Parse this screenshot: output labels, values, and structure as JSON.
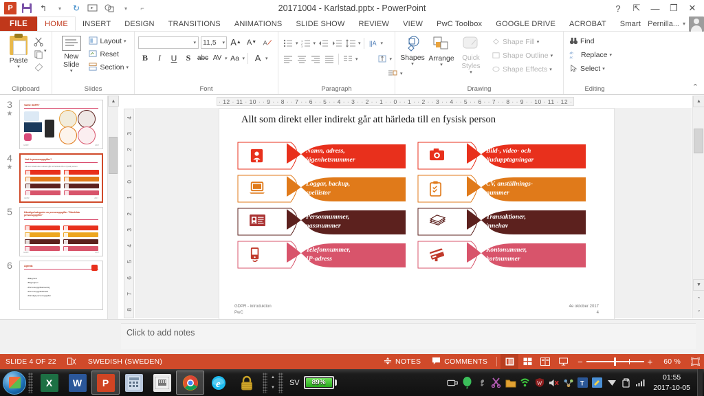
{
  "window": {
    "title": "20171004 - Karlstad.pptx - PowerPoint",
    "app_logo": "P",
    "quick_access": [
      {
        "name": "save",
        "glyph": "save-icon"
      },
      {
        "name": "undo",
        "glyph": "↰"
      },
      {
        "name": "redo",
        "glyph": "↻"
      },
      {
        "name": "start-slideshow",
        "glyph": "▭"
      },
      {
        "name": "shapes-qat",
        "glyph": "◇"
      },
      {
        "name": "customize-qat",
        "glyph": "▾"
      }
    ],
    "controls": {
      "help": "?",
      "ribbon_display": "⇱",
      "minimize": "—",
      "restore": "❐",
      "close": "✕"
    }
  },
  "tabs": {
    "file": "FILE",
    "items": [
      {
        "label": "HOME",
        "active": true
      },
      {
        "label": "INSERT",
        "active": false
      },
      {
        "label": "DESIGN",
        "active": false
      },
      {
        "label": "TRANSITIONS",
        "active": false
      },
      {
        "label": "ANIMATIONS",
        "active": false
      },
      {
        "label": "SLIDE SHOW",
        "active": false
      },
      {
        "label": "REVIEW",
        "active": false
      },
      {
        "label": "VIEW",
        "active": false
      },
      {
        "label": "PwC Toolbox",
        "active": false
      },
      {
        "label": "GOOGLE DRIVE",
        "active": false
      },
      {
        "label": "ACROBAT",
        "active": false
      },
      {
        "label": "Smart",
        "active": false
      }
    ],
    "account_name": "Pernilla...",
    "account_caret": "▾"
  },
  "ribbon": {
    "groups": [
      {
        "name": "clipboard",
        "label": "Clipboard",
        "paste_label": "Paste",
        "paste_caret": "▾",
        "items": [
          {
            "label": "Cut",
            "icon": "scissors-icon"
          },
          {
            "label": "Copy",
            "icon": "copy-icon"
          },
          {
            "label": "Format Painter",
            "icon": "format-painter-icon"
          }
        ]
      },
      {
        "name": "slides",
        "label": "Slides",
        "new_slide_label": "New Slide",
        "new_slide_caret": "▾",
        "items": [
          {
            "label": "Layout",
            "caret": "▾"
          },
          {
            "label": "Reset",
            "caret": ""
          },
          {
            "label": "Section",
            "caret": "▾"
          }
        ]
      },
      {
        "name": "font",
        "label": "Font",
        "font_name": "",
        "font_size": "11,5",
        "grow_font": "A",
        "shrink_font": "A",
        "clear_formatting": "Aᵈ",
        "buttons": [
          {
            "label": "B",
            "name": "bold"
          },
          {
            "label": "I",
            "name": "italic"
          },
          {
            "label": "U",
            "name": "underline"
          },
          {
            "label": "S",
            "name": "shadow"
          },
          {
            "label": "abc",
            "name": "strikethrough"
          },
          {
            "label": "AV",
            "name": "character-spacing"
          },
          {
            "label": "Aa",
            "name": "change-case"
          },
          {
            "label": "A",
            "name": "font-color"
          }
        ]
      },
      {
        "name": "paragraph",
        "label": "Paragraph"
      },
      {
        "name": "drawing",
        "label": "Drawing",
        "shapes_label": "Shapes",
        "arrange_label": "Arrange",
        "quick_styles_label": "Quick Styles",
        "items": [
          {
            "label": "Shape Fill",
            "caret": "▾",
            "disabled": true
          },
          {
            "label": "Shape Outline",
            "caret": "▾",
            "disabled": true
          },
          {
            "label": "Shape Effects",
            "caret": "▾",
            "disabled": true
          }
        ]
      },
      {
        "name": "editing",
        "label": "Editing",
        "items": [
          {
            "label": "Find",
            "caret": "",
            "icon": "binoculars-icon"
          },
          {
            "label": "Replace",
            "caret": "▾",
            "icon": "replace-icon"
          },
          {
            "label": "Select",
            "caret": "▾",
            "icon": "cursor-icon"
          }
        ]
      }
    ],
    "collapse_caret": "⌃"
  },
  "rulers": {
    "horizontal": "· 12 · 11 · 10 · · 9 · · 8 · · 7 · · 6 · · 5 · · 4 · · 3 · · 2 · · 1 · ·  0 · · 1 · · 2 · · 3 · · 4 · · 5 · · 6 · · 7 · · 8 · · 9 · · 10 · 11 · 12 ·",
    "vertical": [
      "4",
      "3",
      "2",
      "1",
      "0",
      "1",
      "2",
      "3",
      "4",
      "5",
      "6",
      "7",
      "8"
    ]
  },
  "slide_panel": {
    "scroll_up": "▲",
    "scroll_down": "▼",
    "thumbnails": [
      {
        "number": "3",
        "selected": false,
        "has_animation": true,
        "title": "Varför GDPR?",
        "kind": "circles"
      },
      {
        "number": "4",
        "selected": true,
        "has_animation": true,
        "title": "Vad är personuppgifter?",
        "subtitle": "Allt som direkt eller indirekt går att härleda till en fysisk person",
        "kind": "banners"
      },
      {
        "number": "5",
        "selected": false,
        "has_animation": false,
        "title": "Känsliga kategorier av personuppgifter \"Särskilda personuppgifter\"",
        "kind": "banners"
      },
      {
        "number": "6",
        "selected": false,
        "has_animation": false,
        "title": "Agenda",
        "kind": "bullets",
        "bullets": [
          "Bakgrund",
          "Begreppen",
          "Personuppgiftsansvarig",
          "Personuppgiftsbiträde",
          "Känsliga personuppgifter"
        ]
      }
    ]
  },
  "slide": {
    "title": "Allt som direkt eller indirekt går att härleda till en fysisk person",
    "footer_left_line1": "GDPR - introduktion",
    "footer_left_line2": "PwC",
    "footer_right_line1": "4e oktober 2017",
    "footer_right_line2": "4",
    "banners": [
      {
        "label": "Namn, adress,\nlägenhetsnummer",
        "color": "#e8301c",
        "icon": "contact-card-icon"
      },
      {
        "label": "Bild-, video- och\nljudupptagningar",
        "color": "#e8301c",
        "icon": "camera-icon"
      },
      {
        "label": "Loggar, backup,\nspellistor",
        "color": "#e07a1a",
        "icon": "laptop-icon"
      },
      {
        "label": "CV, anställnings-\nnummer",
        "color": "#e07a1a",
        "icon": "clipboard-check-icon"
      },
      {
        "label": "Personnummer,\npassnummer",
        "color": "#5c211e",
        "icon": "id-card-icon"
      },
      {
        "label": "Transaktioner,\ninnehav",
        "color": "#5c211e",
        "icon": "banknotes-icon"
      },
      {
        "label": "Telefonnummer,\nIP-adress",
        "color": "#d8546b",
        "icon": "mobile-phone-icon"
      },
      {
        "label": "Kontonummer,\nkortnummer",
        "color": "#d8546b",
        "icon": "credit-card-icon"
      }
    ]
  },
  "notes": {
    "placeholder": "Click to add notes"
  },
  "status_bar": {
    "slide_indicator": "SLIDE 4 OF 22",
    "language": "SWEDISH (SWEDEN)",
    "notes_label": "NOTES",
    "comments_label": "COMMENTS",
    "zoom_level": "60 %",
    "zoom_out": "−",
    "zoom_in": "+",
    "views": [
      {
        "name": "normal-view",
        "glyph": "▤",
        "active": true
      },
      {
        "name": "slide-sorter-view",
        "glyph": "▦",
        "active": false
      },
      {
        "name": "reading-view",
        "glyph": "▥",
        "active": false
      },
      {
        "name": "slide-show-view",
        "glyph": "⌸",
        "active": false
      }
    ],
    "fit_to_window": "⛶"
  },
  "taskbar": {
    "start": "start-orb",
    "apps": [
      {
        "name": "excel",
        "label": "X",
        "color": "#1d7044",
        "active": false
      },
      {
        "name": "word",
        "label": "W",
        "color": "#2b579a",
        "active": false
      },
      {
        "name": "powerpoint",
        "label": "P",
        "color": "#d04423",
        "active": true
      },
      {
        "name": "calculator",
        "label": "🖩",
        "color": "#cfd8e8",
        "active": false
      },
      {
        "name": "network-adapter",
        "label": "▤",
        "color": "#e8e8e8",
        "active": false
      },
      {
        "name": "chrome",
        "label": "◉",
        "color": "#4285f4",
        "active": true
      },
      {
        "name": "internet-explorer",
        "label": "e",
        "color": "#1ebbee",
        "active": false
      },
      {
        "name": "keepass",
        "label": "🔒",
        "color": "#d4a017",
        "active": false
      }
    ],
    "language": "SV",
    "battery_percent": "89%",
    "clock_time": "01:55",
    "clock_date": "2017-10-05"
  }
}
